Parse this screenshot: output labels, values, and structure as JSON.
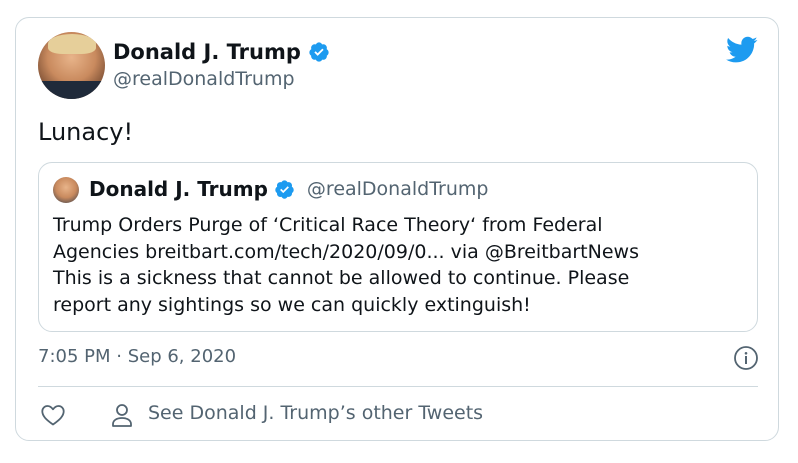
{
  "tweet": {
    "author_name": "Donald J. Trump",
    "author_handle": "@realDonaldTrump",
    "text": "Lunacy!",
    "timestamp": "7:05 PM · Sep 6, 2020",
    "verified_icon": "verified-badge-icon",
    "brand_icon": "twitter-bird-icon"
  },
  "quoted": {
    "author_name": "Donald J. Trump",
    "author_handle": "@realDonaldTrump",
    "lines": [
      "Trump Orders Purge of ‘Critical Race Theory‘ from Federal",
      "Agencies breitbart.com/tech/2020/09/0... via @BreitbartNews",
      "This is a sickness that cannot be allowed to continue. Please",
      "report any sightings so we can quickly extinguish!"
    ]
  },
  "footer": {
    "other_tweets_label": "See Donald J. Trump’s other Tweets",
    "like_icon": "heart-icon",
    "profile_icon": "person-icon",
    "info_icon": "info-icon"
  },
  "colors": {
    "twitter_blue": "#1d9bf0",
    "secondary_text": "#536471",
    "border": "#cfd9de"
  }
}
